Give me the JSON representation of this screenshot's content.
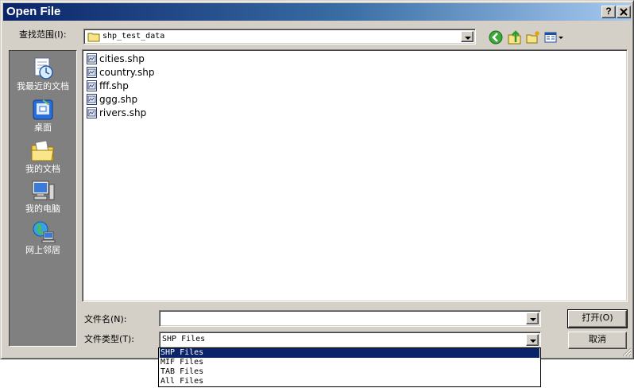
{
  "window": {
    "title": "Open File",
    "help_label": "?",
    "close_label": "X"
  },
  "lookin": {
    "label": "查找范围(I):",
    "value": "shp_test_data"
  },
  "places": [
    {
      "label": "我最近的文档",
      "icon": "recent-documents-icon"
    },
    {
      "label": "桌面",
      "icon": "desktop-icon"
    },
    {
      "label": "我的文档",
      "icon": "my-documents-icon"
    },
    {
      "label": "我的电脑",
      "icon": "my-computer-icon"
    },
    {
      "label": "网上邻居",
      "icon": "network-places-icon"
    }
  ],
  "files": [
    {
      "name": "cities.shp"
    },
    {
      "name": "country.shp"
    },
    {
      "name": "fff.shp"
    },
    {
      "name": "ggg.shp"
    },
    {
      "name": "rivers.shp"
    }
  ],
  "filename": {
    "label": "文件名(N):",
    "value": ""
  },
  "filetype": {
    "label": "文件类型(T):",
    "value": "SHP Files",
    "options": [
      "SHP Files",
      "MIF Files",
      "TAB Files",
      "All Files"
    ]
  },
  "buttons": {
    "open": "打开(O)",
    "cancel": "取消"
  },
  "colors": {
    "dialog_bg": "#d4d0c8",
    "title_gradient_start": "#0a246a",
    "title_gradient_end": "#a6caf0",
    "places_bg": "#808080",
    "selection": "#0a246a"
  }
}
